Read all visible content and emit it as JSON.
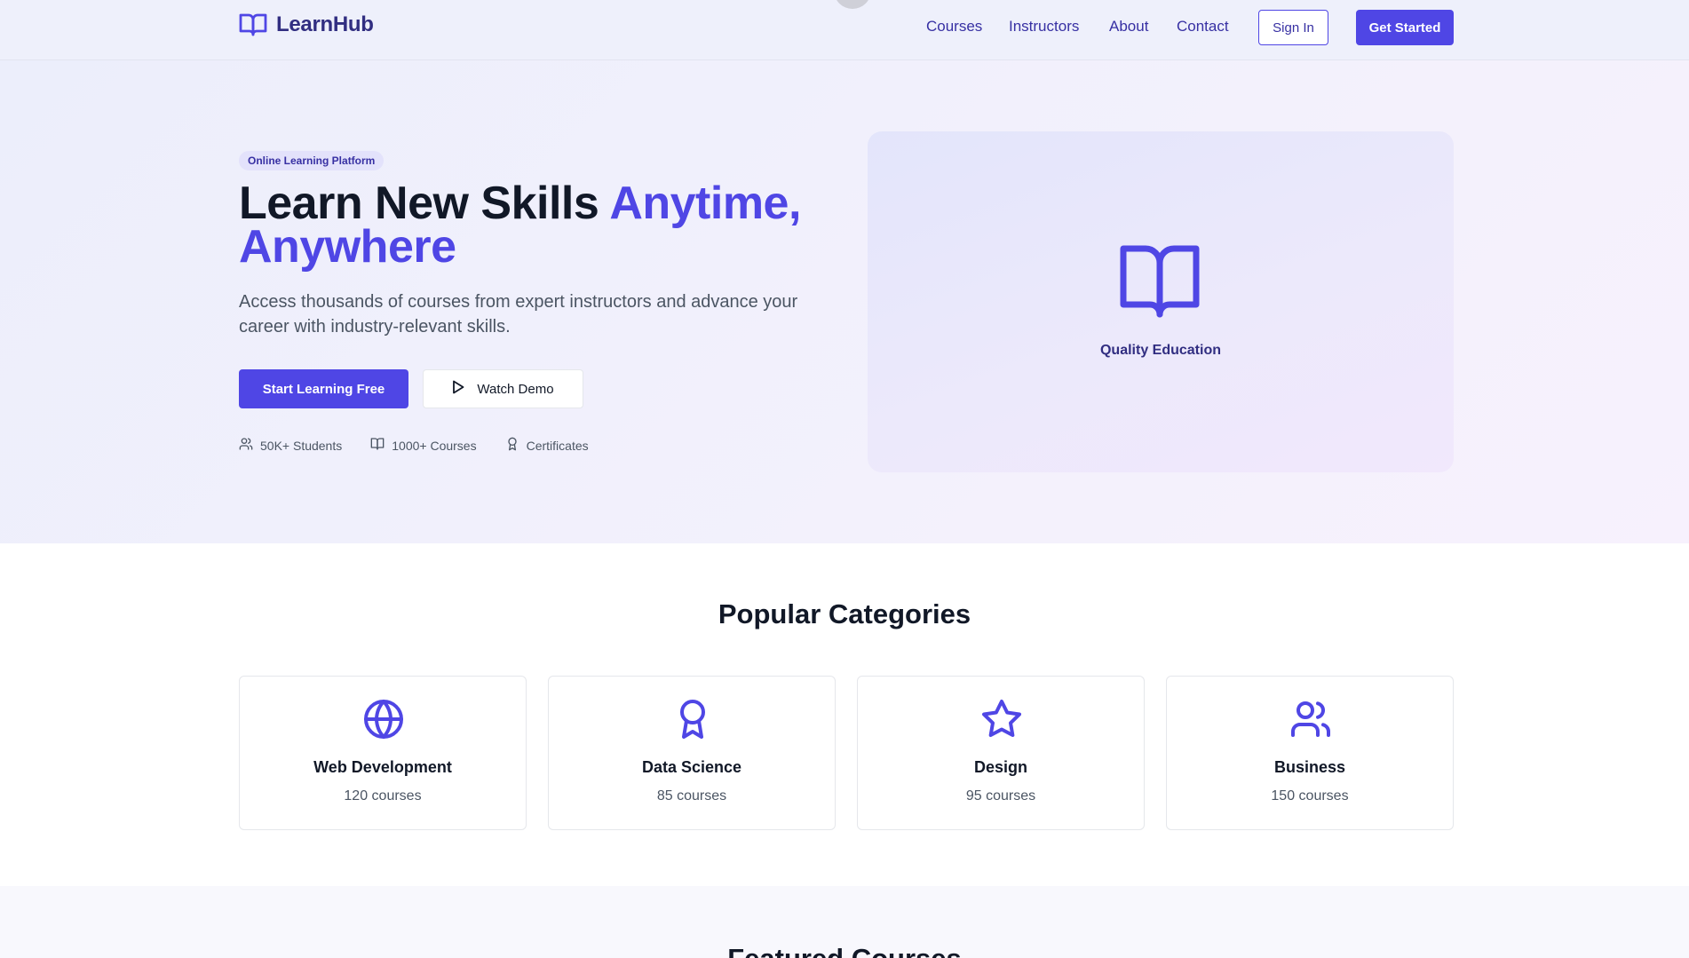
{
  "colors": {
    "brand": "#4f46e5",
    "brand_dark": "#312e81",
    "text": "#111827",
    "muted": "#4b5563"
  },
  "nav": {
    "brand_name": "LearnHub",
    "brand_icon": "open-book-icon",
    "links": [
      "Courses",
      "Instructors",
      "About",
      "Contact"
    ],
    "sign_in": "Sign In",
    "get_started": "Get Started"
  },
  "hero": {
    "badge": "Online Learning Platform",
    "title_plain": "Learn New Skills ",
    "title_accent": "Anytime, Anywhere",
    "subtitle": "Access thousands of courses from expert instructors and advance your career with industry-relevant skills.",
    "primary_cta": "Start Learning Free",
    "secondary_cta": "Watch Demo",
    "secondary_icon": "play-icon",
    "stats": [
      {
        "icon": "users-icon",
        "label": "50K+ Students"
      },
      {
        "icon": "book-icon",
        "label": "1000+ Courses"
      },
      {
        "icon": "award-icon",
        "label": "Certificates"
      }
    ],
    "card": {
      "icon": "open-book-icon",
      "label": "Quality Education"
    }
  },
  "categories": {
    "title": "Popular Categories",
    "items": [
      {
        "icon": "globe-icon",
        "name": "Web Development",
        "count": "120 courses"
      },
      {
        "icon": "award-icon",
        "name": "Data Science",
        "count": "85 courses"
      },
      {
        "icon": "star-icon",
        "name": "Design",
        "count": "95 courses"
      },
      {
        "icon": "users-icon",
        "name": "Business",
        "count": "150 courses"
      }
    ]
  },
  "featured": {
    "title": "Featured Courses"
  }
}
